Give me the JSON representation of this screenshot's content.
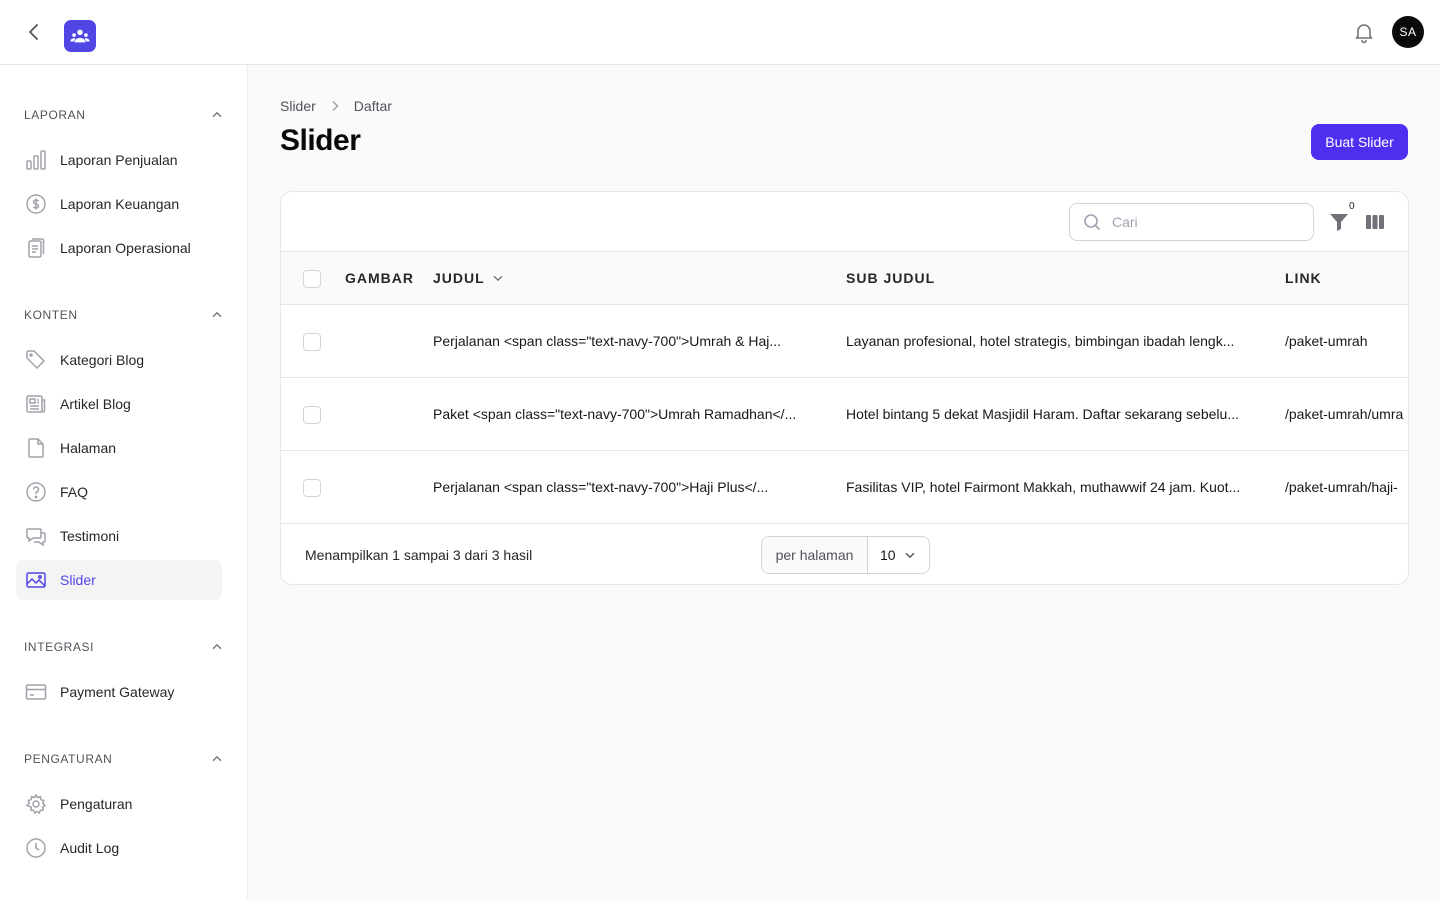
{
  "header": {
    "back_label": "back",
    "user_initials": "SA"
  },
  "sidebar": {
    "groups": [
      {
        "label": "LAPORAN",
        "items": [
          {
            "label": "Laporan Penjualan",
            "icon": "bar-chart-icon"
          },
          {
            "label": "Laporan Keuangan",
            "icon": "currency-dollar-icon"
          },
          {
            "label": "Laporan Operasional",
            "icon": "clipboard-icon"
          }
        ]
      },
      {
        "label": "KONTEN",
        "items": [
          {
            "label": "Kategori Blog",
            "icon": "tag-icon"
          },
          {
            "label": "Artikel Blog",
            "icon": "newspaper-icon"
          },
          {
            "label": "Halaman",
            "icon": "document-icon"
          },
          {
            "label": "FAQ",
            "icon": "question-circle-icon"
          },
          {
            "label": "Testimoni",
            "icon": "chat-bubbles-icon"
          },
          {
            "label": "Slider",
            "icon": "photo-icon",
            "active": true
          }
        ]
      },
      {
        "label": "INTEGRASI",
        "items": [
          {
            "label": "Payment Gateway",
            "icon": "credit-card-icon"
          }
        ]
      },
      {
        "label": "PENGATURAN",
        "items": [
          {
            "label": "Pengaturan",
            "icon": "cog-icon"
          },
          {
            "label": "Audit Log",
            "icon": "clock-icon"
          }
        ]
      }
    ]
  },
  "breadcrumb": {
    "parent": "Slider",
    "current": "Daftar"
  },
  "page": {
    "title": "Slider",
    "create_button": "Buat Slider"
  },
  "table": {
    "search_placeholder": "Cari",
    "filter_count": "0",
    "columns": {
      "image": "GAMBAR",
      "title": "JUDUL",
      "subtitle": "SUB JUDUL",
      "link": "LINK"
    },
    "rows": [
      {
        "title": "Perjalanan <span class=\"text-navy-700\">Umrah & Haj...",
        "subtitle": "Layanan profesional, hotel strategis, bimbingan ibadah lengk...",
        "link": "/paket-umrah"
      },
      {
        "title": "Paket <span class=\"text-navy-700\">Umrah Ramadhan</...",
        "subtitle": "Hotel bintang 5 dekat Masjidil Haram. Daftar sekarang sebelu...",
        "link": "/paket-umrah/umra"
      },
      {
        "title": "Perjalanan <span class=\"text-navy-700\">Haji Plus</...",
        "subtitle": "Fasilitas VIP, hotel Fairmont Makkah, muthawwif 24 jam. Kuot...",
        "link": "/paket-umrah/haji-"
      }
    ],
    "results_text": "Menampilkan 1 sampai 3 dari 3 hasil",
    "per_page_label": "per halaman",
    "per_page_value": "10"
  },
  "colors": {
    "accent": "#4f46e5",
    "primary_button": "#4f2ef0"
  }
}
